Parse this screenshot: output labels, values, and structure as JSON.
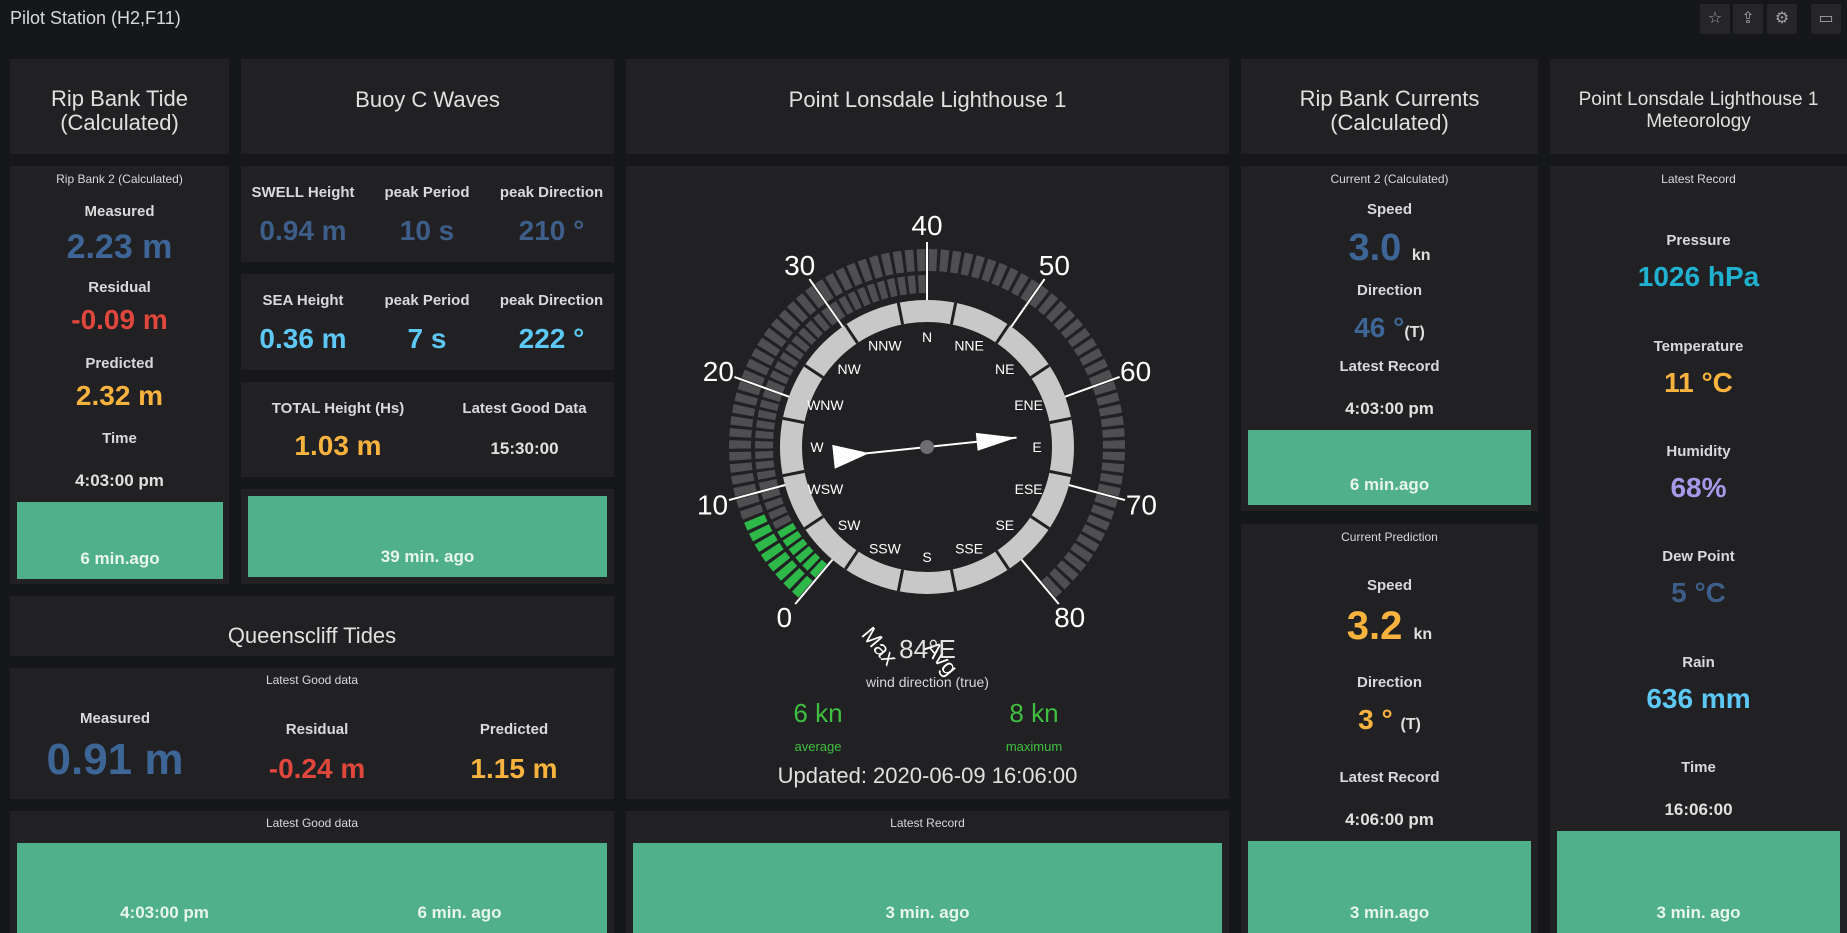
{
  "app": {
    "title": "Pilot Station (H2,F11)",
    "toolbar": {
      "star_icon": "star-icon",
      "share_icon": "share-icon",
      "settings_icon": "gear-icon",
      "tv_icon": "monitor-icon"
    }
  },
  "rip_tide": {
    "title": "Rip Bank Tide (Calculated)",
    "sub": "Rip Bank 2 (Calculated)",
    "measured_label": "Measured",
    "measured_value": "2.23 m",
    "residual_label": "Residual",
    "residual_value": "-0.09 m",
    "predicted_label": "Predicted",
    "predicted_value": "2.32 m",
    "time_label": "Time",
    "time_value": "4:03:00 pm",
    "age": "6 min.ago"
  },
  "buoy": {
    "title": "Buoy C Waves",
    "swell_h_label": "SWELL Height",
    "swell_h": "0.94 m",
    "swell_p_label": "peak Period",
    "swell_p": "10 s",
    "swell_d_label": "peak Direction",
    "swell_d": "210 °",
    "sea_h_label": "SEA Height",
    "sea_h": "0.36 m",
    "sea_p_label": "peak Period",
    "sea_p": "7 s",
    "sea_d_label": "peak Direction",
    "sea_d": "222 °",
    "total_label": "TOTAL Height (Hs)",
    "total": "1.03 m",
    "good_label": "Latest Good Data",
    "good_time": "15:30:00",
    "age": "39 min. ago"
  },
  "queenscliff": {
    "title": "Queenscliff Tides",
    "sub": "Latest Good data",
    "measured_label": "Measured",
    "measured_value": "0.91 m",
    "residual_label": "Residual",
    "residual_value": "-0.24 m",
    "predicted_label": "Predicted",
    "predicted_value": "1.15 m",
    "sub2": "Latest Good data",
    "time": "4:03:00 pm",
    "age": "6 min. ago"
  },
  "lighthouse": {
    "title": "Point Lonsdale Lighthouse 1",
    "outer_ticks": [
      "0",
      "10",
      "20",
      "30",
      "40",
      "50",
      "60",
      "70",
      "80"
    ],
    "compass": [
      "N",
      "NNE",
      "NE",
      "ENE",
      "E",
      "ESE",
      "SE",
      "SSE",
      "S",
      "SSW",
      "SW",
      "WSW",
      "W",
      "WNW",
      "NW",
      "NNW"
    ],
    "max_label": "Max",
    "avg_label": "Avg",
    "direction": "84°E",
    "direction_label": "wind direction (true)",
    "avg_speed": "6 kn",
    "avg_label2": "average",
    "max_speed": "8 kn",
    "max_label2": "maximum",
    "updated": "Updated: 2020-06-09 16:06:00",
    "wind_direction_deg": 84,
    "avg_speed_kn": 6,
    "max_speed_kn": 8,
    "scale_max_kn": 80,
    "latest_label": "Latest Record",
    "age": "3 min. ago"
  },
  "currents": {
    "title": "Rip Bank Currents (Calculated)",
    "sub": "Current 2 (Calculated)",
    "speed_label": "Speed",
    "speed": "3.0",
    "speed_unit": "kn",
    "dir_label": "Direction",
    "dir": "46 °",
    "dir_unit": "(T)",
    "latest_label": "Latest Record",
    "latest_time": "4:03:00 pm",
    "age": "6 min.ago",
    "pred_sub": "Current Prediction",
    "pred_speed_label": "Speed",
    "pred_speed": "3.2",
    "pred_speed_unit": "kn",
    "pred_dir_label": "Direction",
    "pred_dir": "3 °",
    "pred_dir_unit": "(T)",
    "pred_latest_label": "Latest Record",
    "pred_latest_time": "4:06:00 pm",
    "pred_age": "3 min.ago"
  },
  "met": {
    "title": "Point Lonsdale Lighthouse 1 Meteorology",
    "sub": "Latest Record",
    "pressure_label": "Pressure",
    "pressure": "1026 hPa",
    "temp_label": "Temperature",
    "temp": "11 °C",
    "humidity_label": "Humidity",
    "humidity": "68%",
    "dew_label": "Dew Point",
    "dew": "5 °C",
    "rain_label": "Rain",
    "rain": "636 mm",
    "time_label": "Time",
    "time": "16:06:00",
    "age": "3 min. ago"
  },
  "colors": {
    "background": "#161719",
    "panel": "#212124",
    "green_bar": "#50b08c",
    "blue": "#3d6697",
    "red": "#e0473c",
    "orange": "#f8b33e",
    "light_blue": "#5ec8f4",
    "wind_green": "#3fbf3f"
  }
}
